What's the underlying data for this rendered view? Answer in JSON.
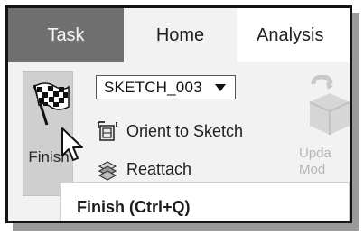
{
  "tabs": [
    {
      "label": "Task",
      "active": false
    },
    {
      "label": "Home",
      "active": true
    },
    {
      "label": "Analysis",
      "active": false
    }
  ],
  "ribbon": {
    "finish": {
      "label": "Finish",
      "icon": "checkered-flag-icon"
    },
    "sketch_selector": {
      "value": "SKETCH_003"
    },
    "orient_to_sketch": {
      "label": "Orient to Sketch",
      "icon": "orient-to-sketch-icon"
    },
    "reattach": {
      "label": "Reattach",
      "icon": "reattach-icon"
    },
    "update": {
      "label_line1": "Upda",
      "label_line2": "Mod",
      "icon": "update-model-icon",
      "enabled": false
    }
  },
  "tooltip": {
    "text": "Finish (Ctrl+Q)"
  },
  "colors": {
    "task_tab_bg": "#6f6f6f",
    "ribbon_bg": "#f2f2f2",
    "finish_button_bg": "#cfcfcf",
    "frame_border": "#141414"
  }
}
